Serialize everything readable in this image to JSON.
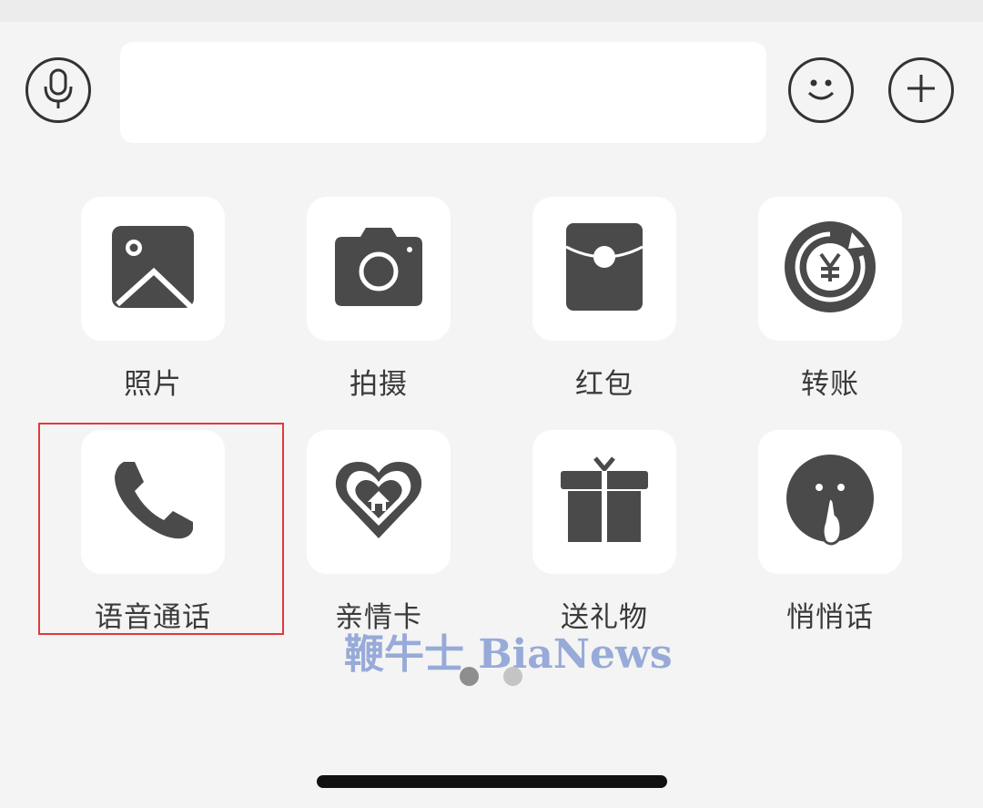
{
  "input_bar": {
    "voice_icon": "microphone-icon",
    "emoji_icon": "smiley-icon",
    "more_icon": "plus-icon",
    "text_value": ""
  },
  "panel": {
    "items": [
      {
        "label": "照片",
        "icon": "photo-icon"
      },
      {
        "label": "拍摄",
        "icon": "camera-icon"
      },
      {
        "label": "红包",
        "icon": "red-packet-icon"
      },
      {
        "label": "转账",
        "icon": "transfer-icon"
      },
      {
        "label": "语音通话",
        "icon": "phone-icon"
      },
      {
        "label": "亲情卡",
        "icon": "family-card-icon"
      },
      {
        "label": "送礼物",
        "icon": "gift-icon"
      },
      {
        "label": "悄悄话",
        "icon": "whisper-icon"
      }
    ],
    "page_indicator": {
      "current": 1,
      "total": 2
    }
  },
  "highlight_target": "语音通话",
  "watermark": "鞭牛士 BiaNews",
  "colors": {
    "icon": "#4a4a4a",
    "tile_bg": "#ffffff",
    "panel_bg": "#f4f4f4",
    "highlight_border": "#e23a3a",
    "watermark": "#8da3d6",
    "dot_active": "#8e8e8e",
    "dot_inactive": "#c4c4c4"
  }
}
